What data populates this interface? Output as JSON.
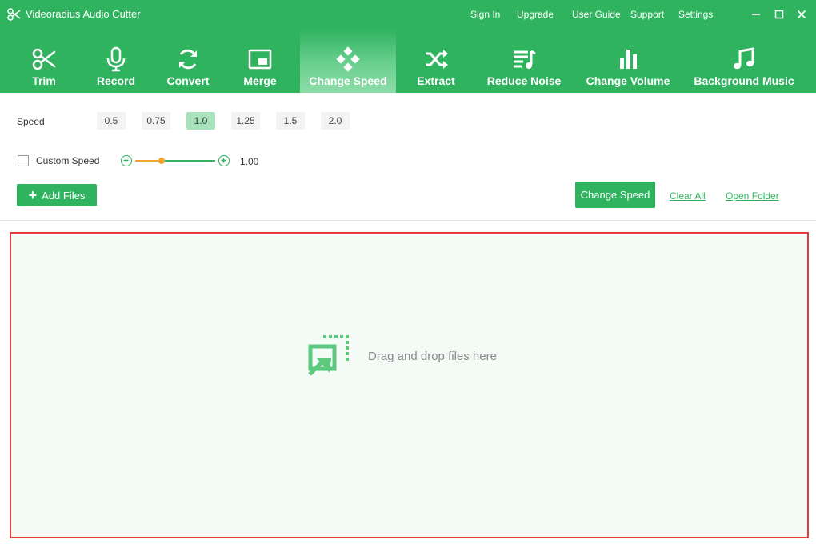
{
  "app": {
    "title": "Videoradius Audio Cutter",
    "accent_color": "#2fb35f",
    "logo_icon": "scissors-icon"
  },
  "top_menu": [
    {
      "label": "Sign In"
    },
    {
      "label": "Upgrade"
    },
    {
      "label": "User Guide"
    },
    {
      "label": "Support"
    },
    {
      "label": "Settings"
    }
  ],
  "window_controls": [
    "minimize-icon",
    "maximize-icon",
    "close-icon"
  ],
  "toolbar": {
    "active": "Change Speed",
    "tools": [
      {
        "label": "Trim",
        "icon": "scissors-icon"
      },
      {
        "label": "Record",
        "icon": "microphone-icon"
      },
      {
        "label": "Convert",
        "icon": "refresh-icon"
      },
      {
        "label": "Merge",
        "icon": "merge-icon"
      },
      {
        "label": "Change Speed",
        "icon": "speed-icon"
      },
      {
        "label": "Extract",
        "icon": "shuffle-icon"
      },
      {
        "label": "Reduce Noise",
        "icon": "playlist-icon"
      },
      {
        "label": "Change Volume",
        "icon": "volume-bars-icon"
      },
      {
        "label": "Background Music",
        "icon": "music-note-icon"
      }
    ]
  },
  "speed": {
    "label": "Speed",
    "options": [
      "0.5",
      "0.75",
      "1.0",
      "1.25",
      "1.5",
      "2.0"
    ],
    "selected": "1.0",
    "selected_color": "#a9e3bc"
  },
  "custom_speed": {
    "label": "Custom Speed",
    "checked": false,
    "value": "1.00",
    "level": 0.33,
    "thumb_color": "#f4a52e"
  },
  "actions": {
    "add_files": "Add Files",
    "change_speed": "Change Speed",
    "clear_all": "Clear All",
    "open_folder": "Open Folder"
  },
  "dropzone": {
    "text": "Drag and drop files here",
    "border_color": "#e43a3a"
  }
}
